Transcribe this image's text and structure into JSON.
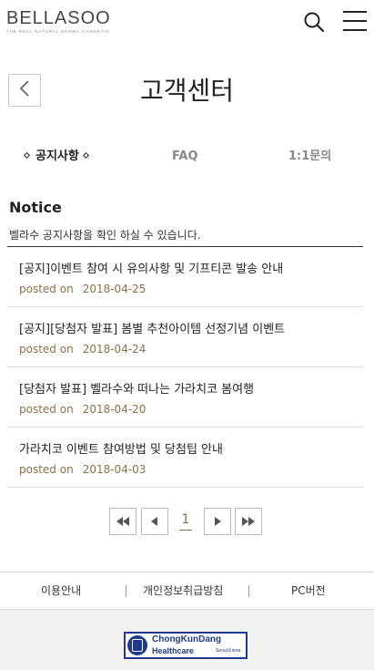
{
  "header": {
    "logo_main": "BELLASOO",
    "logo_sub": "THE REAL NATURAL DERMA COSMETIC",
    "search_icon": "search-icon",
    "menu_icon": "hamburger-menu-icon"
  },
  "page": {
    "title": "고객센터",
    "back_icon": "chevron-left-icon"
  },
  "tabs": [
    {
      "label": "공지사항",
      "active": true
    },
    {
      "label": "FAQ",
      "active": false
    },
    {
      "label": "1:1문의",
      "active": false
    }
  ],
  "notice": {
    "title": "Notice",
    "description": "벨라수 공지사항을 확인 하실 수 있습니다.",
    "posted_label": "posted on",
    "items": [
      {
        "title": "[공지]이벤트 참여 시 유의사항 및 기프티콘 발송 안내",
        "date": "2018-04-25"
      },
      {
        "title": "[공지][당첨자 발표] 봄별 추천아이템 선정기념 이벤트",
        "date": "2018-04-24"
      },
      {
        "title": "[당첨자 발표] 벨라수와 떠나는 가라치코 봄여행",
        "date": "2018-04-20"
      },
      {
        "title": "가라치코 이벤트 참여방법 및 당첨팁 안내",
        "date": "2018-04-03"
      }
    ]
  },
  "pagination": {
    "current_page": "1",
    "first_icon": "double-chevron-left-icon",
    "prev_icon": "triangle-left-icon",
    "next_icon": "triangle-right-icon",
    "last_icon": "double-chevron-right-icon"
  },
  "footer": {
    "links": [
      "이용안내",
      "개인정보취급방침",
      "PC버전"
    ],
    "brand_line1": "ChongKunDang",
    "brand_line2": "Healthcare",
    "brand_line3": "Seoul,Korea"
  },
  "colors": {
    "accent": "#8a7146",
    "brand_blue": "#1f3a8a"
  }
}
